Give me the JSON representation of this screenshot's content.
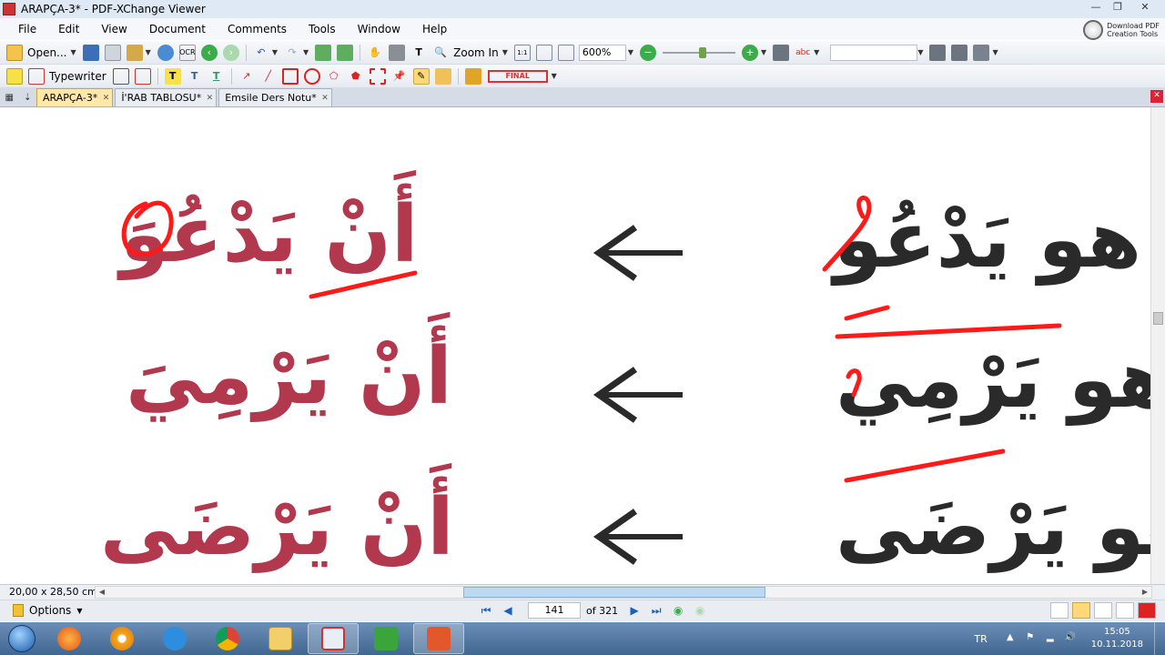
{
  "window": {
    "title": "ARAPÇA-3* - PDF-XChange Viewer",
    "controls": [
      "—",
      "❐",
      "✕"
    ]
  },
  "menu": [
    "File",
    "Edit",
    "View",
    "Document",
    "Comments",
    "Tools",
    "Window",
    "Help"
  ],
  "download_pdf": {
    "line1": "Download PDF",
    "line2": "Creation Tools"
  },
  "toolbar1": {
    "open_label": "Open...",
    "ocr_label": "OCR",
    "zoom_in_label": "Zoom In",
    "zoom_value": "600%"
  },
  "toolbar2": {
    "typewriter_label": "Typewriter",
    "stamp_label": "FINAL"
  },
  "tabs": [
    {
      "label": "ARAPÇA-3*",
      "active": true
    },
    {
      "label": "İ'RAB TABLOSU*",
      "active": false
    },
    {
      "label": "Emsile Ders Notu*",
      "active": false
    }
  ],
  "document": {
    "rows": [
      {
        "left": "أَنْ يَدْعُوَ",
        "right": "هو يَدْعُو"
      },
      {
        "left": "أَنْ يَرْمِيَ",
        "right": "هو يَرْمِي"
      },
      {
        "left": "أَنْ يَرْضَى",
        "right": "هُو يَرْضَى"
      }
    ],
    "annotation_color": "#ff1a1a",
    "left_text_color": "#b2384d",
    "right_text_color": "#2a2a2a"
  },
  "status": {
    "page_size": "20,00 x 28,50 cm"
  },
  "navigation": {
    "options_label": "Options",
    "current_page": "141",
    "total_pages": "of 321"
  },
  "taskbar": {
    "apps": [
      "firefox-icon",
      "media-player-icon",
      "internet-explorer-icon",
      "chrome-icon",
      "file-explorer-icon",
      "pdf-xchange-icon",
      "camtasia-green-icon",
      "camtasia-orange-icon"
    ],
    "language": "TR",
    "time": "15:05",
    "date": "10.11.2018"
  }
}
